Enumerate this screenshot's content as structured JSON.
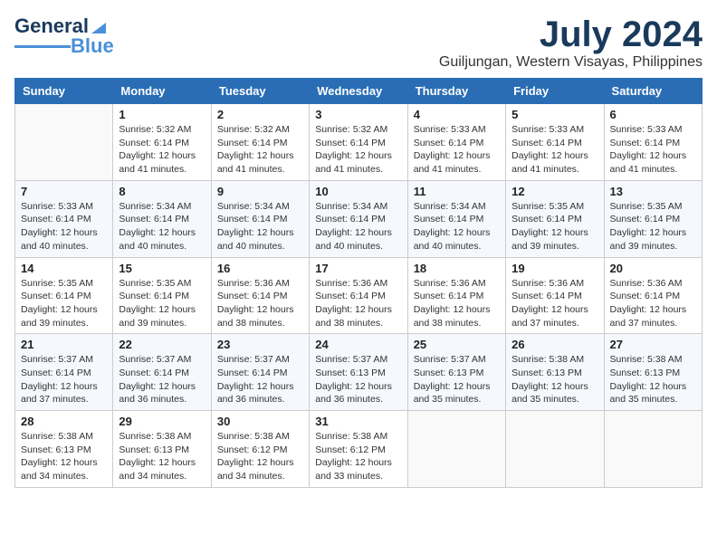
{
  "header": {
    "logo_general": "General",
    "logo_blue": "Blue",
    "month_title": "July 2024",
    "location": "Guiljungan, Western Visayas, Philippines"
  },
  "weekdays": [
    "Sunday",
    "Monday",
    "Tuesday",
    "Wednesday",
    "Thursday",
    "Friday",
    "Saturday"
  ],
  "weeks": [
    [
      {
        "day": "",
        "sunrise": "",
        "sunset": "",
        "daylight": ""
      },
      {
        "day": "1",
        "sunrise": "Sunrise: 5:32 AM",
        "sunset": "Sunset: 6:14 PM",
        "daylight": "Daylight: 12 hours and 41 minutes."
      },
      {
        "day": "2",
        "sunrise": "Sunrise: 5:32 AM",
        "sunset": "Sunset: 6:14 PM",
        "daylight": "Daylight: 12 hours and 41 minutes."
      },
      {
        "day": "3",
        "sunrise": "Sunrise: 5:32 AM",
        "sunset": "Sunset: 6:14 PM",
        "daylight": "Daylight: 12 hours and 41 minutes."
      },
      {
        "day": "4",
        "sunrise": "Sunrise: 5:33 AM",
        "sunset": "Sunset: 6:14 PM",
        "daylight": "Daylight: 12 hours and 41 minutes."
      },
      {
        "day": "5",
        "sunrise": "Sunrise: 5:33 AM",
        "sunset": "Sunset: 6:14 PM",
        "daylight": "Daylight: 12 hours and 41 minutes."
      },
      {
        "day": "6",
        "sunrise": "Sunrise: 5:33 AM",
        "sunset": "Sunset: 6:14 PM",
        "daylight": "Daylight: 12 hours and 41 minutes."
      }
    ],
    [
      {
        "day": "7",
        "sunrise": "Sunrise: 5:33 AM",
        "sunset": "Sunset: 6:14 PM",
        "daylight": "Daylight: 12 hours and 40 minutes."
      },
      {
        "day": "8",
        "sunrise": "Sunrise: 5:34 AM",
        "sunset": "Sunset: 6:14 PM",
        "daylight": "Daylight: 12 hours and 40 minutes."
      },
      {
        "day": "9",
        "sunrise": "Sunrise: 5:34 AM",
        "sunset": "Sunset: 6:14 PM",
        "daylight": "Daylight: 12 hours and 40 minutes."
      },
      {
        "day": "10",
        "sunrise": "Sunrise: 5:34 AM",
        "sunset": "Sunset: 6:14 PM",
        "daylight": "Daylight: 12 hours and 40 minutes."
      },
      {
        "day": "11",
        "sunrise": "Sunrise: 5:34 AM",
        "sunset": "Sunset: 6:14 PM",
        "daylight": "Daylight: 12 hours and 40 minutes."
      },
      {
        "day": "12",
        "sunrise": "Sunrise: 5:35 AM",
        "sunset": "Sunset: 6:14 PM",
        "daylight": "Daylight: 12 hours and 39 minutes."
      },
      {
        "day": "13",
        "sunrise": "Sunrise: 5:35 AM",
        "sunset": "Sunset: 6:14 PM",
        "daylight": "Daylight: 12 hours and 39 minutes."
      }
    ],
    [
      {
        "day": "14",
        "sunrise": "Sunrise: 5:35 AM",
        "sunset": "Sunset: 6:14 PM",
        "daylight": "Daylight: 12 hours and 39 minutes."
      },
      {
        "day": "15",
        "sunrise": "Sunrise: 5:35 AM",
        "sunset": "Sunset: 6:14 PM",
        "daylight": "Daylight: 12 hours and 39 minutes."
      },
      {
        "day": "16",
        "sunrise": "Sunrise: 5:36 AM",
        "sunset": "Sunset: 6:14 PM",
        "daylight": "Daylight: 12 hours and 38 minutes."
      },
      {
        "day": "17",
        "sunrise": "Sunrise: 5:36 AM",
        "sunset": "Sunset: 6:14 PM",
        "daylight": "Daylight: 12 hours and 38 minutes."
      },
      {
        "day": "18",
        "sunrise": "Sunrise: 5:36 AM",
        "sunset": "Sunset: 6:14 PM",
        "daylight": "Daylight: 12 hours and 38 minutes."
      },
      {
        "day": "19",
        "sunrise": "Sunrise: 5:36 AM",
        "sunset": "Sunset: 6:14 PM",
        "daylight": "Daylight: 12 hours and 37 minutes."
      },
      {
        "day": "20",
        "sunrise": "Sunrise: 5:36 AM",
        "sunset": "Sunset: 6:14 PM",
        "daylight": "Daylight: 12 hours and 37 minutes."
      }
    ],
    [
      {
        "day": "21",
        "sunrise": "Sunrise: 5:37 AM",
        "sunset": "Sunset: 6:14 PM",
        "daylight": "Daylight: 12 hours and 37 minutes."
      },
      {
        "day": "22",
        "sunrise": "Sunrise: 5:37 AM",
        "sunset": "Sunset: 6:14 PM",
        "daylight": "Daylight: 12 hours and 36 minutes."
      },
      {
        "day": "23",
        "sunrise": "Sunrise: 5:37 AM",
        "sunset": "Sunset: 6:14 PM",
        "daylight": "Daylight: 12 hours and 36 minutes."
      },
      {
        "day": "24",
        "sunrise": "Sunrise: 5:37 AM",
        "sunset": "Sunset: 6:13 PM",
        "daylight": "Daylight: 12 hours and 36 minutes."
      },
      {
        "day": "25",
        "sunrise": "Sunrise: 5:37 AM",
        "sunset": "Sunset: 6:13 PM",
        "daylight": "Daylight: 12 hours and 35 minutes."
      },
      {
        "day": "26",
        "sunrise": "Sunrise: 5:38 AM",
        "sunset": "Sunset: 6:13 PM",
        "daylight": "Daylight: 12 hours and 35 minutes."
      },
      {
        "day": "27",
        "sunrise": "Sunrise: 5:38 AM",
        "sunset": "Sunset: 6:13 PM",
        "daylight": "Daylight: 12 hours and 35 minutes."
      }
    ],
    [
      {
        "day": "28",
        "sunrise": "Sunrise: 5:38 AM",
        "sunset": "Sunset: 6:13 PM",
        "daylight": "Daylight: 12 hours and 34 minutes."
      },
      {
        "day": "29",
        "sunrise": "Sunrise: 5:38 AM",
        "sunset": "Sunset: 6:13 PM",
        "daylight": "Daylight: 12 hours and 34 minutes."
      },
      {
        "day": "30",
        "sunrise": "Sunrise: 5:38 AM",
        "sunset": "Sunset: 6:12 PM",
        "daylight": "Daylight: 12 hours and 34 minutes."
      },
      {
        "day": "31",
        "sunrise": "Sunrise: 5:38 AM",
        "sunset": "Sunset: 6:12 PM",
        "daylight": "Daylight: 12 hours and 33 minutes."
      },
      {
        "day": "",
        "sunrise": "",
        "sunset": "",
        "daylight": ""
      },
      {
        "day": "",
        "sunrise": "",
        "sunset": "",
        "daylight": ""
      },
      {
        "day": "",
        "sunrise": "",
        "sunset": "",
        "daylight": ""
      }
    ]
  ]
}
